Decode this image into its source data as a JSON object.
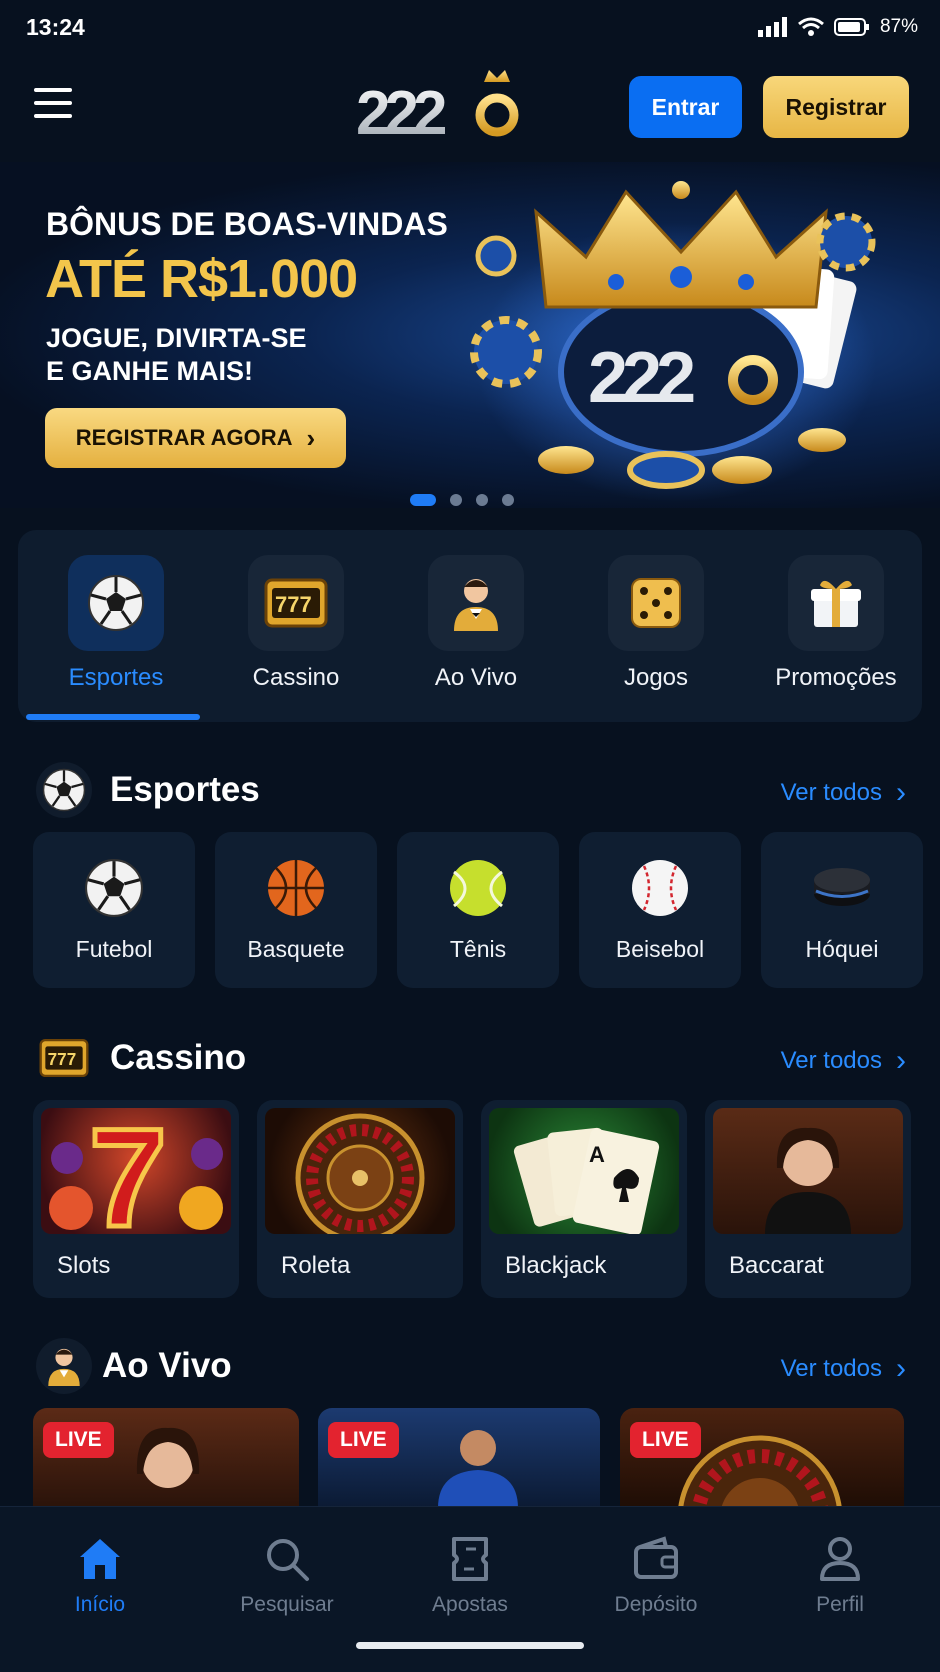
{
  "status": {
    "time": "13:24",
    "battery": "87%"
  },
  "header": {
    "logo_text": "2220",
    "login_label": "Entrar",
    "register_label": "Registrar"
  },
  "banner": {
    "line1": "BÔNUS DE BOAS-VINDAS",
    "line2": "ATÉ R$1.000",
    "line3a": "JOGUE, DIVIRTA-SE",
    "line3b": "E GANHE MAIS!",
    "cta": "REGISTRAR AGORA",
    "crown_logo": "2220",
    "slides": 4,
    "active_slide": 1
  },
  "categories": [
    {
      "label": "Esportes",
      "icon": "soccer-ball-icon",
      "active": true
    },
    {
      "label": "Cassino",
      "icon": "slot-777-icon",
      "active": false
    },
    {
      "label": "Ao Vivo",
      "icon": "dealer-icon",
      "active": false
    },
    {
      "label": "Jogos",
      "icon": "dice-icon",
      "active": false
    },
    {
      "label": "Promoções",
      "icon": "gift-icon",
      "active": false
    }
  ],
  "sports_section": {
    "title": "Esportes",
    "more": "Ver todos",
    "items": [
      {
        "label": "Futebol",
        "icon": "soccer-ball-icon"
      },
      {
        "label": "Basquete",
        "icon": "basketball-icon"
      },
      {
        "label": "Tênis",
        "icon": "tennis-ball-icon"
      },
      {
        "label": "Beisebol",
        "icon": "baseball-icon"
      },
      {
        "label": "Hóquei",
        "icon": "hockey-puck-icon"
      }
    ]
  },
  "casino_section": {
    "title": "Cassino",
    "more": "Ver todos",
    "items": [
      {
        "label": "Slots"
      },
      {
        "label": "Roleta"
      },
      {
        "label": "Blackjack"
      },
      {
        "label": "Baccarat"
      }
    ]
  },
  "live_section": {
    "title": "Ao Vivo",
    "more": "Ver todos",
    "badge": "LIVE"
  },
  "bottom_nav": [
    {
      "label": "Início",
      "icon": "home-icon",
      "active": true
    },
    {
      "label": "Pesquisar",
      "icon": "search-icon",
      "active": false
    },
    {
      "label": "Apostas",
      "icon": "bet-slip-icon",
      "active": false
    },
    {
      "label": "Depósito",
      "icon": "wallet-icon",
      "active": false
    },
    {
      "label": "Perfil",
      "icon": "user-icon",
      "active": false
    }
  ],
  "colors": {
    "accent": "#1f7cf6",
    "gold": "#f3c54b",
    "background": "#07111f",
    "live": "#e3232f"
  }
}
